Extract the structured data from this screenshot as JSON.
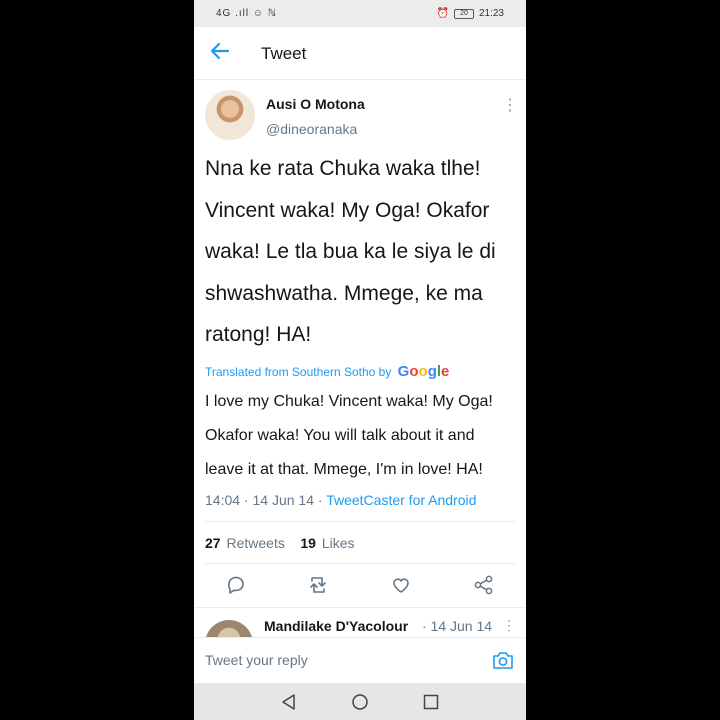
{
  "statusbar": {
    "left": "4G .ıll ☺ ℕ",
    "battery": "20",
    "time": "21:23"
  },
  "header": {
    "title": "Tweet"
  },
  "tweet": {
    "author_name": "Ausi O Motona",
    "author_handle": "@dineoranaka",
    "text": "Nna ke rata Chuka waka tlhe!\nVincent waka! My Oga! Okafor\nwaka! Le tla bua ka le siya le di\nshwashwatha. Mmege, ke ma\nratong! HA!",
    "translated_prefix": "Translated from Southern Sotho by",
    "translation_provider": "Google",
    "translation": "I love my Chuka! Vincent waka! My Oga!\nOkafor waka! You will talk about it and\nleave it at that. Mmege, I'm in love! HA!",
    "time": "14:04",
    "date": "14 Jun 14",
    "client": "TweetCaster for Android",
    "retweets_count": "27",
    "retweets_label": "Retweets",
    "likes_count": "19",
    "likes_label": "Likes"
  },
  "reply_preview": {
    "name": "Mandilake D'Yacolour",
    "date": "· 14 Jun 14"
  },
  "compose": {
    "placeholder": "Tweet your reply"
  },
  "colors": {
    "accent": "#1d9bf0",
    "text": "#14171a",
    "muted": "#657786"
  },
  "icons": {
    "back": "arrow-left-icon",
    "more": "more-vertical-icon",
    "reply": "comment-icon",
    "retweet": "retweet-icon",
    "like": "heart-icon",
    "share": "share-icon",
    "camera": "camera-icon",
    "nav_back": "triangle-back-icon",
    "nav_home": "circle-home-icon",
    "nav_recent": "square-recent-icon"
  }
}
